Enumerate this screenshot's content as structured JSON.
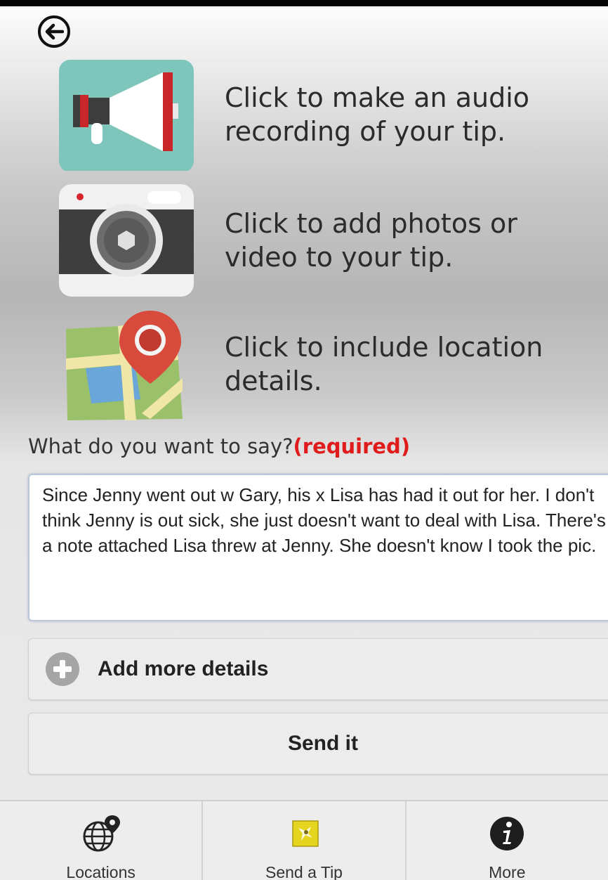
{
  "header": {
    "back_icon": "arrow-left-circle-icon"
  },
  "options": [
    {
      "icon": "megaphone-icon",
      "text": "Click to make an audio recording of your tip."
    },
    {
      "icon": "camera-icon",
      "text": "Click to add photos or video to your tip."
    },
    {
      "icon": "map-pin-icon",
      "text": "Click to include location details."
    }
  ],
  "form": {
    "prompt": "What do you want to say?",
    "required": "(required)",
    "message": "Since Jenny went out w Gary, his x Lisa has had it out for her. I don't think Jenny is out sick, she just doesn't want to deal with Lisa. There's a note attached Lisa threw at Jenny. She doesn't know I took the pic.",
    "add_details_label": "Add more details",
    "add_details_icon": "plus-circle-icon",
    "send_label": "Send it"
  },
  "tabs": [
    {
      "icon": "globe-pin-icon",
      "label": "Locations"
    },
    {
      "icon": "tip-app-icon",
      "label": "Send a Tip"
    },
    {
      "icon": "info-icon",
      "label": "More"
    }
  ],
  "colors": {
    "required": "#e01b1b",
    "megaphone_bg": "#7ec5bc",
    "map_pin": "#d84a3c",
    "tip_icon": "#e5d51f"
  }
}
